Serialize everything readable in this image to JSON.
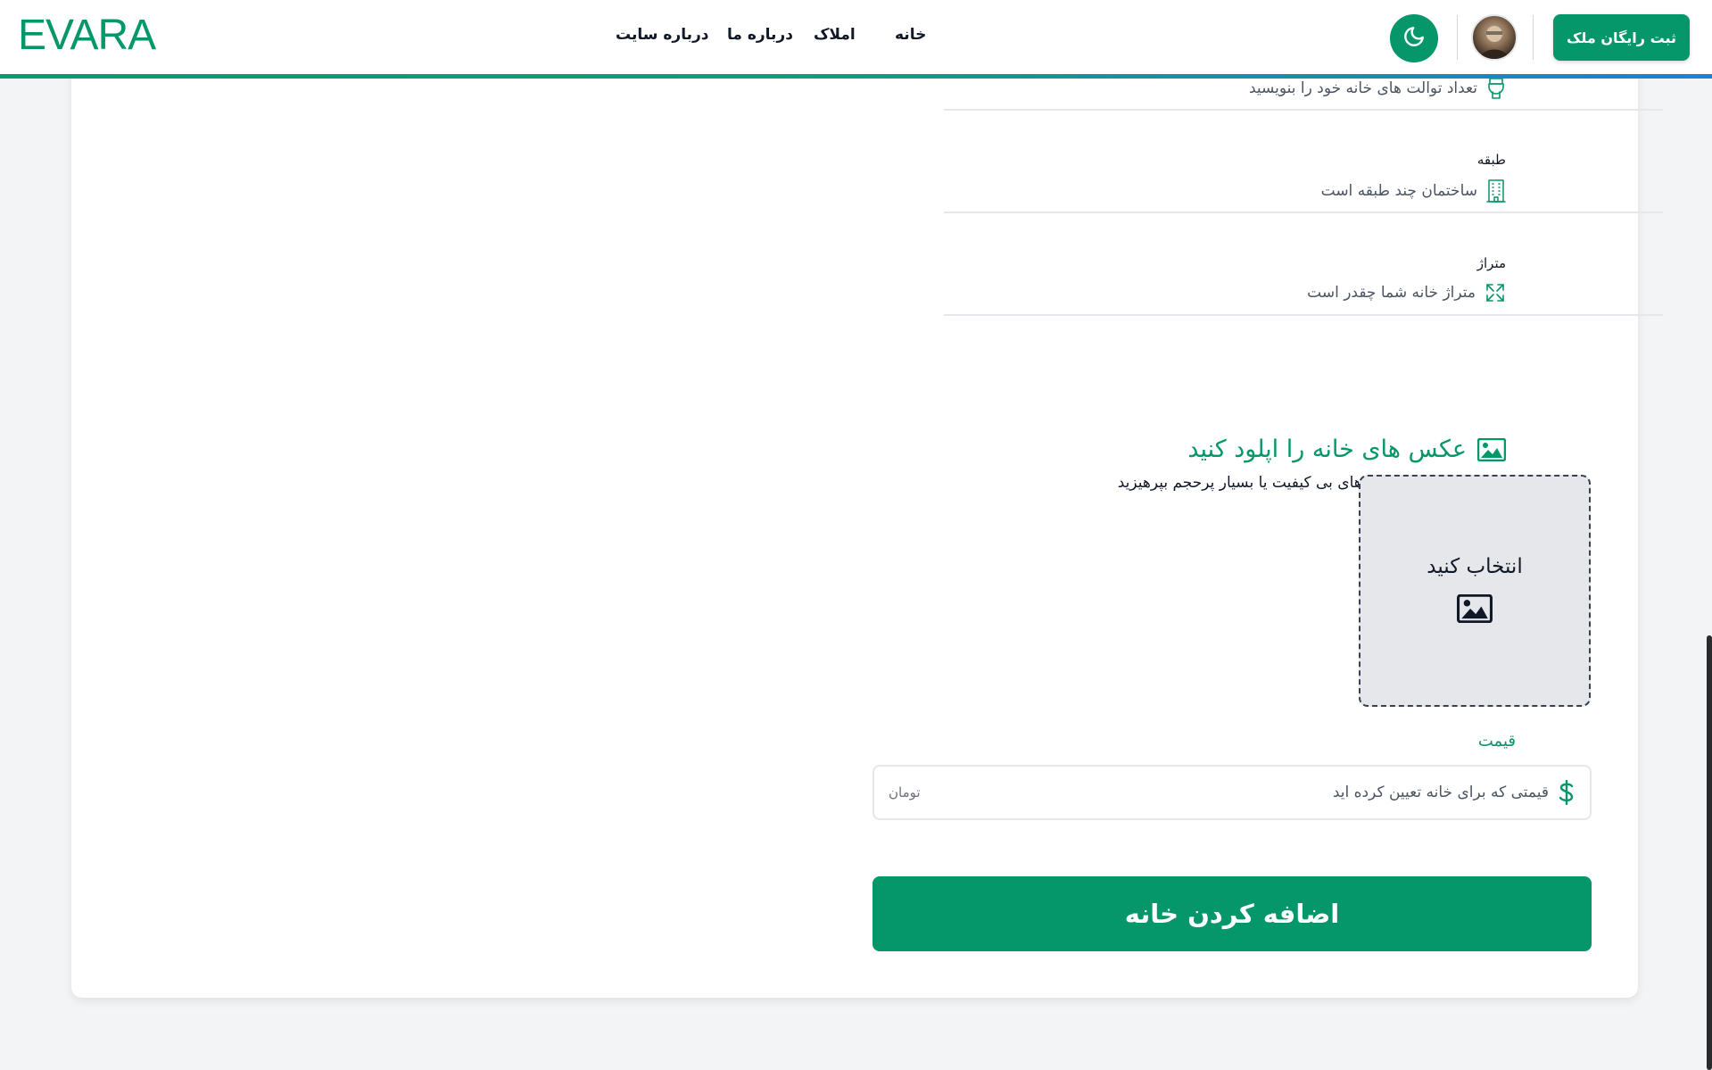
{
  "header": {
    "logo": "EVARA",
    "nav": {
      "home": "خانه",
      "properties": "املاک",
      "about_us": "درباره ما",
      "about_site": "درباره سایت"
    },
    "register_label": "ثبت رایگان ملک",
    "theme_icon": "moon-icon",
    "accent": "#059669"
  },
  "form": {
    "toilets": {
      "placeholder": "تعداد توالت های خانه خود را بنویسید",
      "icon": "toilet-icon"
    },
    "floor": {
      "label": "طبقه",
      "placeholder": "ساختمان چند طبقه است",
      "icon": "building-icon"
    },
    "area": {
      "label": "متراژ",
      "placeholder": "متراژ خانه شما چقدر است",
      "icon": "expand-icon"
    },
    "upload": {
      "title": "عکس های خانه را اپلود کنید",
      "subtitle": "دقت کنید از اپلود عکس های بی کیفیت یا بسیار پرحجم بپرهیزید",
      "drop_label": "انتخاب کنید",
      "icon": "image-icon"
    },
    "price": {
      "label": "قیمت",
      "placeholder": "قیمتی که برای خانه تعیین کرده اید",
      "unit": "تومان",
      "icon": "dollar-icon"
    },
    "submit_label": "اضافه کردن خانه"
  }
}
